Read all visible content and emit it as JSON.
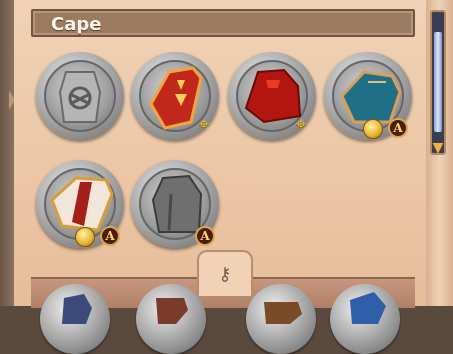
{
  "header": {
    "title": "Cape"
  },
  "items": [
    {
      "name": "Grey cape",
      "has_bow": false,
      "has_coin": false,
      "has_badge": false
    },
    {
      "name": "Orange-red cape with emblem",
      "has_bow": true,
      "has_coin": false,
      "has_badge": false
    },
    {
      "name": "Red cape",
      "has_bow": true,
      "has_coin": false,
      "has_badge": false
    },
    {
      "name": "Teal cape",
      "has_bow": false,
      "has_coin": true,
      "has_badge": true
    },
    {
      "name": "Red and white cape",
      "has_bow": false,
      "has_coin": true,
      "has_badge": true
    },
    {
      "name": "Dark grey cape",
      "has_bow": false,
      "has_coin": false,
      "has_badge": true
    }
  ],
  "badge_letter": "A",
  "colors": {
    "panel": "#ecc7a6",
    "header": "#9b7a62",
    "scroll_track": "#3a3d55",
    "scroll_thumb": "#dfe7ff"
  },
  "icons": {
    "lock": "keyhole-icon",
    "bow": "crossbow-icon",
    "coin": "gold-coin-icon",
    "badge": "rank-a-icon"
  }
}
